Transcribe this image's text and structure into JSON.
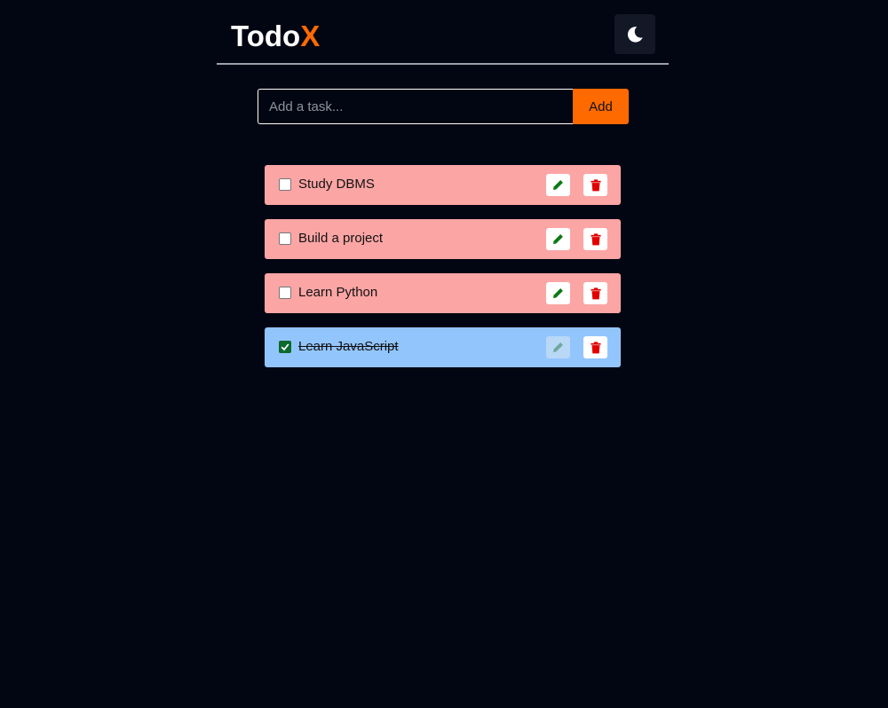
{
  "header": {
    "logo_main": "Todo",
    "logo_accent": "X",
    "theme_toggle_icon": "moon-icon"
  },
  "add_form": {
    "placeholder": "Add a task...",
    "value": "",
    "button_label": "Add"
  },
  "tasks": [
    {
      "label": "Study DBMS",
      "completed": false
    },
    {
      "label": "Build a project",
      "completed": false
    },
    {
      "label": "Learn Python",
      "completed": false
    },
    {
      "label": "Learn JavaScript",
      "completed": true
    }
  ],
  "colors": {
    "background": "#020612",
    "accent": "#ff6a00",
    "pending_task": "#fca5a5",
    "completed_task": "#93c5fd",
    "edit_icon": "#0b7a16",
    "delete_icon": "#e00000"
  },
  "icons": {
    "edit": "pencil-icon",
    "delete": "trash-icon",
    "checkmark": "checkmark-icon"
  }
}
